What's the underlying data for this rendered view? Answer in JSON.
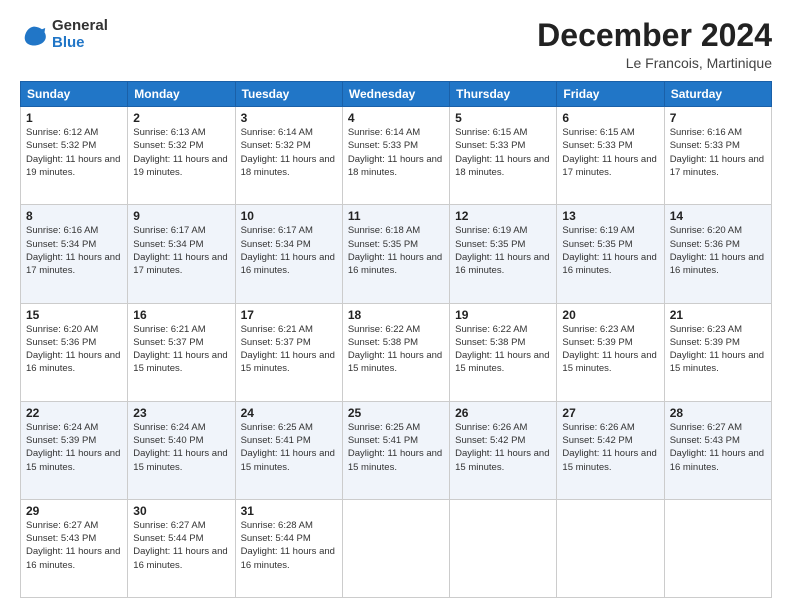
{
  "logo": {
    "general": "General",
    "blue": "Blue"
  },
  "title": "December 2024",
  "location": "Le Francois, Martinique",
  "days_of_week": [
    "Sunday",
    "Monday",
    "Tuesday",
    "Wednesday",
    "Thursday",
    "Friday",
    "Saturday"
  ],
  "weeks": [
    [
      {
        "day": "1",
        "sunrise": "6:12 AM",
        "sunset": "5:32 PM",
        "daylight": "11 hours and 19 minutes."
      },
      {
        "day": "2",
        "sunrise": "6:13 AM",
        "sunset": "5:32 PM",
        "daylight": "11 hours and 19 minutes."
      },
      {
        "day": "3",
        "sunrise": "6:14 AM",
        "sunset": "5:32 PM",
        "daylight": "11 hours and 18 minutes."
      },
      {
        "day": "4",
        "sunrise": "6:14 AM",
        "sunset": "5:33 PM",
        "daylight": "11 hours and 18 minutes."
      },
      {
        "day": "5",
        "sunrise": "6:15 AM",
        "sunset": "5:33 PM",
        "daylight": "11 hours and 18 minutes."
      },
      {
        "day": "6",
        "sunrise": "6:15 AM",
        "sunset": "5:33 PM",
        "daylight": "11 hours and 17 minutes."
      },
      {
        "day": "7",
        "sunrise": "6:16 AM",
        "sunset": "5:33 PM",
        "daylight": "11 hours and 17 minutes."
      }
    ],
    [
      {
        "day": "8",
        "sunrise": "6:16 AM",
        "sunset": "5:34 PM",
        "daylight": "11 hours and 17 minutes."
      },
      {
        "day": "9",
        "sunrise": "6:17 AM",
        "sunset": "5:34 PM",
        "daylight": "11 hours and 17 minutes."
      },
      {
        "day": "10",
        "sunrise": "6:17 AM",
        "sunset": "5:34 PM",
        "daylight": "11 hours and 16 minutes."
      },
      {
        "day": "11",
        "sunrise": "6:18 AM",
        "sunset": "5:35 PM",
        "daylight": "11 hours and 16 minutes."
      },
      {
        "day": "12",
        "sunrise": "6:19 AM",
        "sunset": "5:35 PM",
        "daylight": "11 hours and 16 minutes."
      },
      {
        "day": "13",
        "sunrise": "6:19 AM",
        "sunset": "5:35 PM",
        "daylight": "11 hours and 16 minutes."
      },
      {
        "day": "14",
        "sunrise": "6:20 AM",
        "sunset": "5:36 PM",
        "daylight": "11 hours and 16 minutes."
      }
    ],
    [
      {
        "day": "15",
        "sunrise": "6:20 AM",
        "sunset": "5:36 PM",
        "daylight": "11 hours and 16 minutes."
      },
      {
        "day": "16",
        "sunrise": "6:21 AM",
        "sunset": "5:37 PM",
        "daylight": "11 hours and 15 minutes."
      },
      {
        "day": "17",
        "sunrise": "6:21 AM",
        "sunset": "5:37 PM",
        "daylight": "11 hours and 15 minutes."
      },
      {
        "day": "18",
        "sunrise": "6:22 AM",
        "sunset": "5:38 PM",
        "daylight": "11 hours and 15 minutes."
      },
      {
        "day": "19",
        "sunrise": "6:22 AM",
        "sunset": "5:38 PM",
        "daylight": "11 hours and 15 minutes."
      },
      {
        "day": "20",
        "sunrise": "6:23 AM",
        "sunset": "5:39 PM",
        "daylight": "11 hours and 15 minutes."
      },
      {
        "day": "21",
        "sunrise": "6:23 AM",
        "sunset": "5:39 PM",
        "daylight": "11 hours and 15 minutes."
      }
    ],
    [
      {
        "day": "22",
        "sunrise": "6:24 AM",
        "sunset": "5:39 PM",
        "daylight": "11 hours and 15 minutes."
      },
      {
        "day": "23",
        "sunrise": "6:24 AM",
        "sunset": "5:40 PM",
        "daylight": "11 hours and 15 minutes."
      },
      {
        "day": "24",
        "sunrise": "6:25 AM",
        "sunset": "5:41 PM",
        "daylight": "11 hours and 15 minutes."
      },
      {
        "day": "25",
        "sunrise": "6:25 AM",
        "sunset": "5:41 PM",
        "daylight": "11 hours and 15 minutes."
      },
      {
        "day": "26",
        "sunrise": "6:26 AM",
        "sunset": "5:42 PM",
        "daylight": "11 hours and 15 minutes."
      },
      {
        "day": "27",
        "sunrise": "6:26 AM",
        "sunset": "5:42 PM",
        "daylight": "11 hours and 15 minutes."
      },
      {
        "day": "28",
        "sunrise": "6:27 AM",
        "sunset": "5:43 PM",
        "daylight": "11 hours and 16 minutes."
      }
    ],
    [
      {
        "day": "29",
        "sunrise": "6:27 AM",
        "sunset": "5:43 PM",
        "daylight": "11 hours and 16 minutes."
      },
      {
        "day": "30",
        "sunrise": "6:27 AM",
        "sunset": "5:44 PM",
        "daylight": "11 hours and 16 minutes."
      },
      {
        "day": "31",
        "sunrise": "6:28 AM",
        "sunset": "5:44 PM",
        "daylight": "11 hours and 16 minutes."
      },
      null,
      null,
      null,
      null
    ]
  ]
}
